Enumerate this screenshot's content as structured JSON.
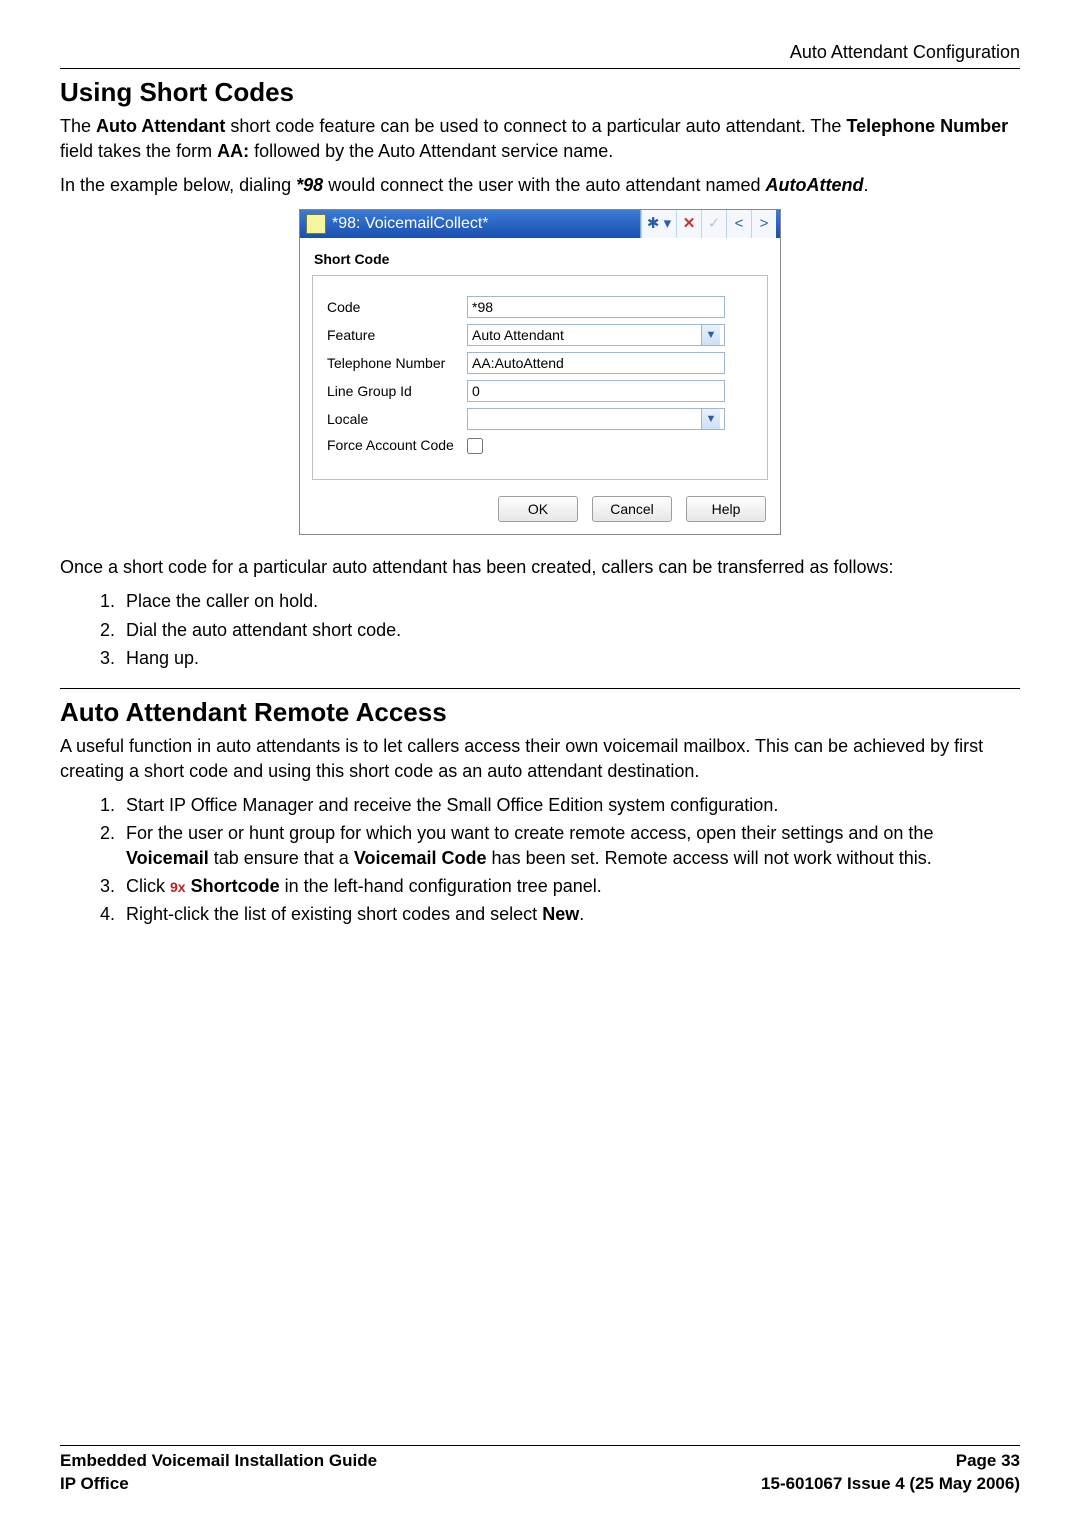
{
  "header_right": "Auto Attendant Configuration",
  "h1_shortcodes": "Using Short Codes",
  "p1_pre": "The ",
  "p1_b1": "Auto Attendant",
  "p1_mid": " short code feature can be used to connect to a particular auto attendant. The ",
  "p1_b2": "Telephone Number",
  "p1_post": " field takes the form ",
  "p1_b3": "AA:",
  "p1_tail": " followed by the Auto Attendant service name.",
  "p2_pre": "In the example below, dialing ",
  "p2_b1": "*98",
  "p2_mid": " would connect the user with the auto attendant named ",
  "p2_b2": "AutoAttend",
  "p2_tail": ".",
  "dlg": {
    "title": "*98: VoicemailCollect*",
    "subtitle": "Short Code",
    "fields": {
      "code_label": "Code",
      "code_value": "*98",
      "feature_label": "Feature",
      "feature_value": "Auto Attendant",
      "tel_label": "Telephone Number",
      "tel_value": "AA:AutoAttend",
      "lg_label": "Line Group Id",
      "lg_value": "0",
      "locale_label": "Locale",
      "locale_value": "",
      "force_label": "Force Account Code"
    },
    "buttons": {
      "ok": "OK",
      "cancel": "Cancel",
      "help": "Help"
    }
  },
  "p3": "Once a short code for a particular auto attendant has been created, callers can be transferred as follows:",
  "steps1": [
    "Place the caller on hold.",
    "Dial the auto attendant short code.",
    "Hang up."
  ],
  "h1_remote": "Auto Attendant Remote Access",
  "p4": "A useful function in auto attendants is to let callers access their own voicemail mailbox. This can be achieved by first creating a short code and using this short code as an auto attendant destination.",
  "steps2": {
    "s1": "Start IP Office Manager and receive the Small Office Edition system configuration.",
    "s2_pre": "For the user or hunt group for which you want to create remote access, open their settings and on the ",
    "s2_b1": "Voicemail",
    "s2_mid": " tab ensure that a ",
    "s2_b2": "Voicemail Code",
    "s2_post": " has been set. Remote access will not work without this.",
    "s3_pre": "Click ",
    "s3_icon_text": "9x",
    "s3_b": " Shortcode",
    "s3_post": " in the left-hand configuration tree panel.",
    "s4_pre": "Right-click the list of existing short codes and select ",
    "s4_b": "New",
    "s4_post": "."
  },
  "footer": {
    "l1_left": "Embedded Voicemail Installation Guide",
    "l1_right": "Page 33",
    "l2_left": "IP Office",
    "l2_right": "15-601067 Issue 4 (25 May 2006)"
  }
}
